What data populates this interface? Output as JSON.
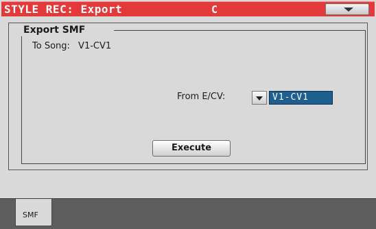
{
  "window": {
    "title": "STYLE REC: Export",
    "key": "C",
    "menu_icon": "chevron-down-icon"
  },
  "panel": {
    "group_title": "Export SMF",
    "to_song_label": "To Song:",
    "to_song_value": "V1-CV1",
    "from_label": "From E/CV:",
    "from_value": "V1-CV1",
    "dropdown_icon": "chevron-down-icon",
    "execute_label": "Execute"
  },
  "tabs": [
    {
      "label": "SMF",
      "selected": true
    }
  ],
  "colors": {
    "titlebar": "#e23a3a",
    "selected_value_bg": "#1f5f8f",
    "panel_bg": "#d9d9d9",
    "tabbar_bg": "#5e5e5e"
  }
}
